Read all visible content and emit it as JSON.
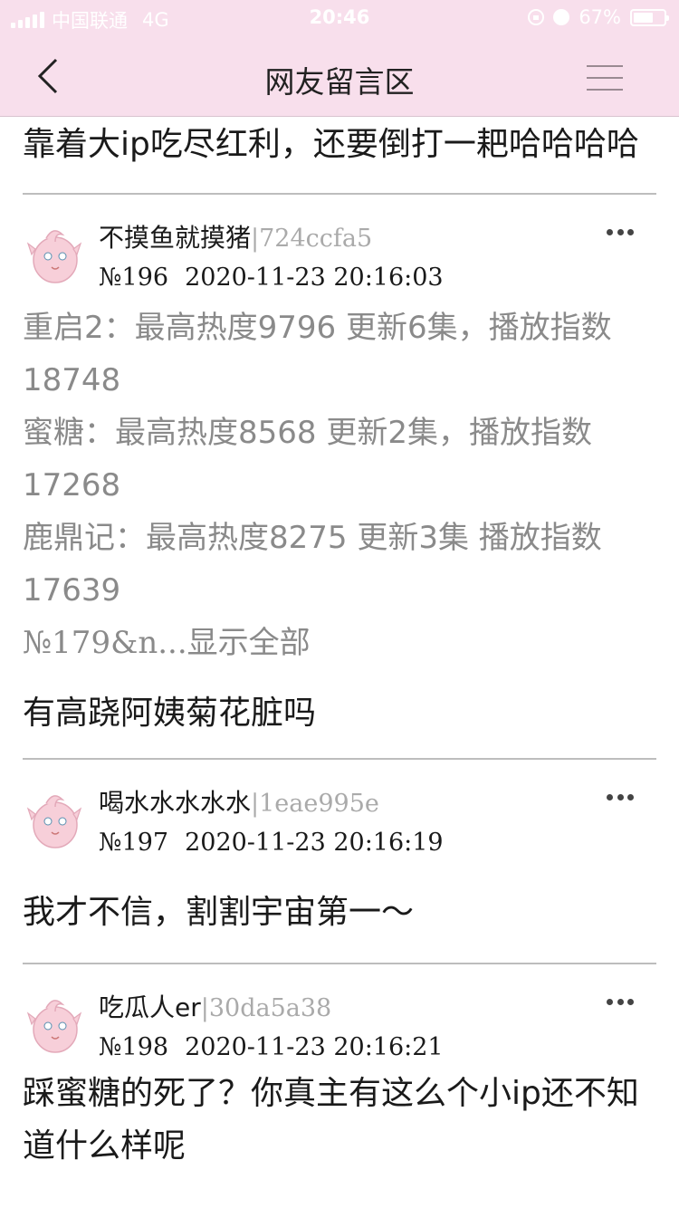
{
  "status_bar": {
    "carrier": "中国联通",
    "network": "4G",
    "time": "20:46",
    "battery": "67%",
    "battery_level": 0.67
  },
  "nav": {
    "title": "网友留言区",
    "back_icon": "chevron-left-icon",
    "menu_icon": "hamburger-menu-icon"
  },
  "top_post": {
    "text": "靠着大ip吃尽红利，还要倒打一耙哈哈哈哈"
  },
  "comments": [
    {
      "username": "不摸鱼就摸猪",
      "uid": "|724ccfa5",
      "number": "№196",
      "datetime": "2020-11-23 20:16:03",
      "quote_lines": [
        "重启2：最高热度9796 更新6集，播放指数18748",
        "蜜糖：最高热度8568 更新2集，播放指数17268",
        "鹿鼎记：最高热度8275 更新3集 播放指数17639"
      ],
      "quote_more": "№179&n...显示全部",
      "text": "有高跷阿姨菊花脏吗"
    },
    {
      "username": "喝水水水水水",
      "uid": "|1eae995e",
      "number": "№197",
      "datetime": "2020-11-23 20:16:19",
      "text": "我才不信，割割宇宙第一～"
    },
    {
      "username": "吃瓜人er",
      "uid": "|30da5a38",
      "number": "№198",
      "datetime": "2020-11-23 20:16:21",
      "text": "踩蜜糖的死了？你真主有这么个小ip还不知道什么样呢"
    }
  ],
  "colors": {
    "header_bg": "#f8dfec",
    "quote_text": "#8a8a8a",
    "uid_text": "#aaaaaa",
    "divider": "#bdbdbd"
  }
}
